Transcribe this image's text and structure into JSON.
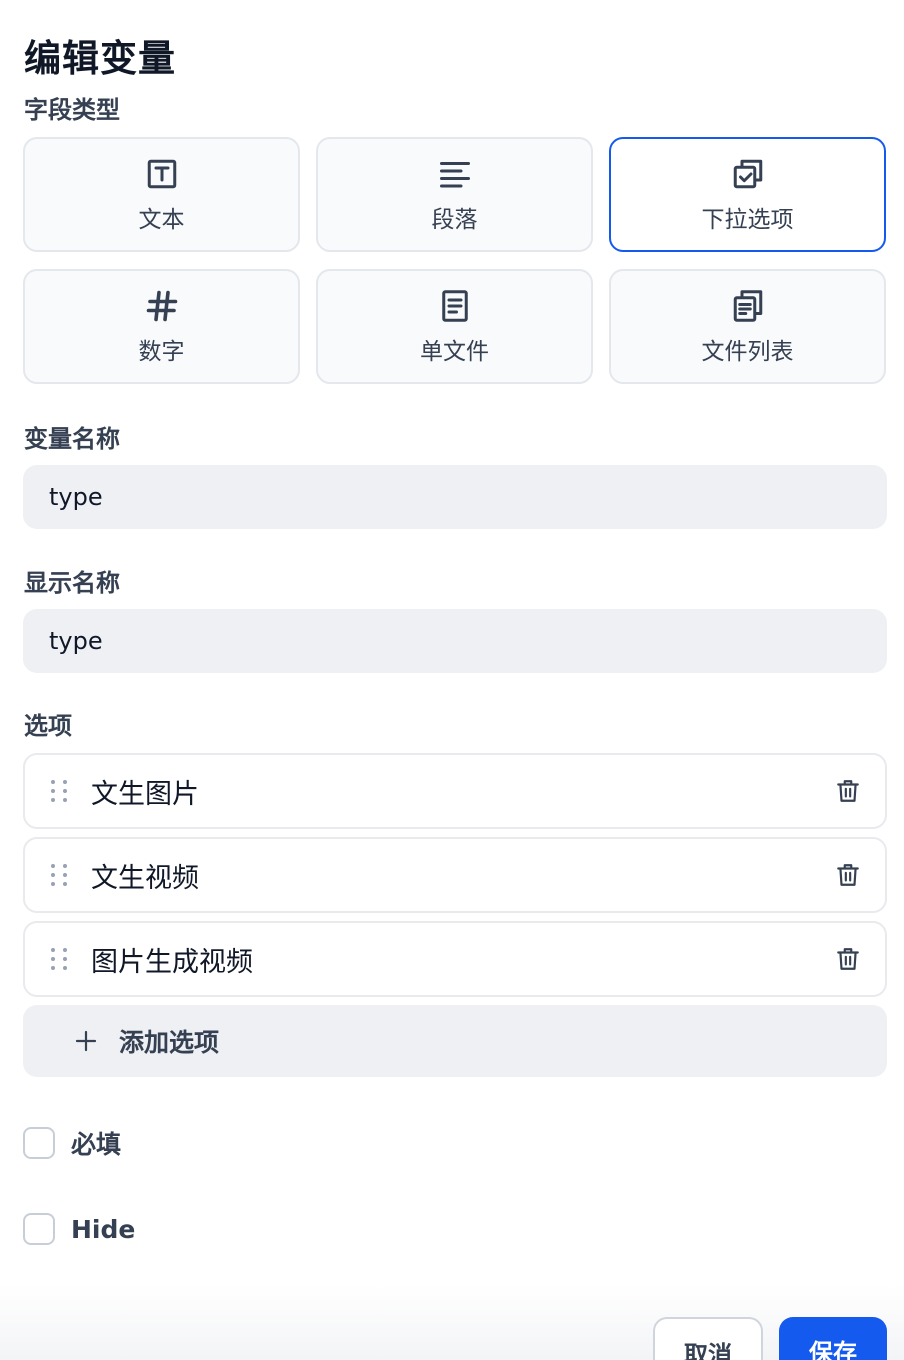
{
  "dialog": {
    "title": "编辑变量"
  },
  "field_type": {
    "label": "字段类型",
    "options": [
      {
        "label": "文本",
        "icon": "text-box-icon",
        "selected": false
      },
      {
        "label": "段落",
        "icon": "paragraph-icon",
        "selected": false
      },
      {
        "label": "下拉选项",
        "icon": "dropdown-select-icon",
        "selected": true
      },
      {
        "label": "数字",
        "icon": "hash-icon",
        "selected": false
      },
      {
        "label": "单文件",
        "icon": "file-icon",
        "selected": false
      },
      {
        "label": "文件列表",
        "icon": "file-list-icon",
        "selected": false
      }
    ]
  },
  "variable_name": {
    "label": "变量名称",
    "value": "type"
  },
  "display_name": {
    "label": "显示名称",
    "value": "type"
  },
  "options": {
    "label": "选项",
    "items": [
      "文生图片",
      "文生视频",
      "图片生成视频"
    ],
    "add_label": "添加选项"
  },
  "required": {
    "label": "必填",
    "checked": false
  },
  "hide": {
    "label": "Hide",
    "checked": false
  },
  "footer": {
    "cancel_label": "取消",
    "save_label": "保存"
  },
  "colors": {
    "accent": "#155aef",
    "input_bg": "#eef0f3",
    "border": "#e4e7ec"
  }
}
